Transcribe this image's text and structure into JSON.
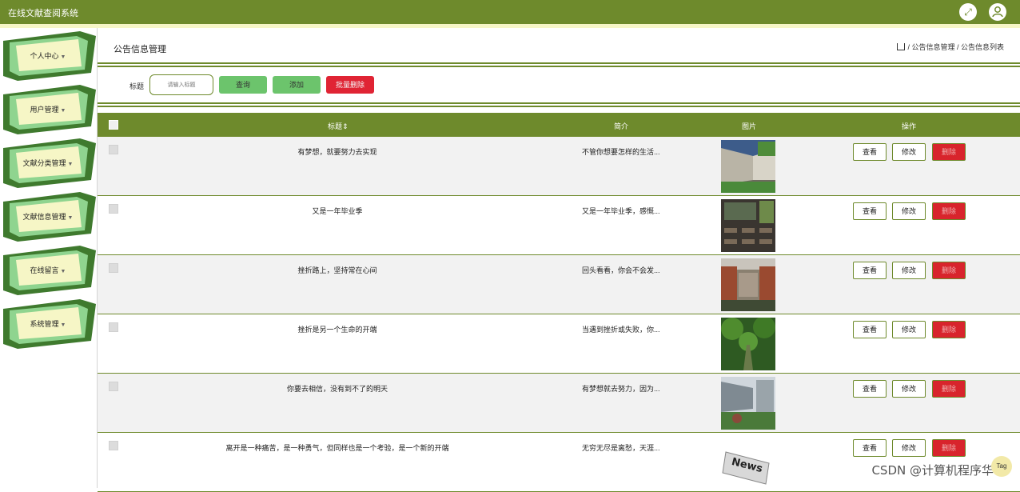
{
  "app": {
    "title": "在线文献查阅系统"
  },
  "header_icons": {
    "fullscreen": "expand-icon",
    "user": "user-icon"
  },
  "sidebar": {
    "items": [
      {
        "label": "个人中心"
      },
      {
        "label": "用户管理"
      },
      {
        "label": "文献分类管理"
      },
      {
        "label": "文献信息管理"
      },
      {
        "label": "在线留言"
      },
      {
        "label": "系统管理"
      }
    ]
  },
  "page": {
    "title": "公告信息管理",
    "breadcrumb": "/ 公告信息管理 / 公告信息列表"
  },
  "search": {
    "label": "标题",
    "placeholder": "请输入标题",
    "query_btn": "查询",
    "add_btn": "添加",
    "batch_delete_btn": "批量删除"
  },
  "table": {
    "headers": {
      "title": "标题",
      "intro": "简介",
      "image": "图片",
      "actions": "操作"
    },
    "actions": {
      "view": "查看",
      "edit": "修改",
      "delete": "删除"
    },
    "rows": [
      {
        "title": "有梦想，就要努力去实现",
        "intro": "不管你想要怎样的生活...",
        "image": "campus-building"
      },
      {
        "title": "又是一年毕业季",
        "intro": "又是一年毕业季，感慨...",
        "image": "classroom"
      },
      {
        "title": "挫折路上，坚持常在心间",
        "intro": "回头看看，你会不会发...",
        "image": "school-courtyard"
      },
      {
        "title": "挫折是另一个生命的开端",
        "intro": "当遇到挫折或失败，你...",
        "image": "tree-lined-path"
      },
      {
        "title": "你要去相信，没有到不了的明天",
        "intro": "有梦想就去努力，因为...",
        "image": "atrium"
      },
      {
        "title": "离开是一种痛苦，是一种勇气，但同样也是一个考验，是一个新的开端",
        "intro": "无穷无尽是离愁，天涯...",
        "image": "news-logo"
      }
    ]
  },
  "overlay": {
    "watermark": "CSDN @计算机程序华哥",
    "badge": "Tag"
  },
  "colors": {
    "primary": "#6e8a2c",
    "button_green": "#6cc46c",
    "button_red": "#e02434",
    "menu_light": "#8fd48f"
  }
}
